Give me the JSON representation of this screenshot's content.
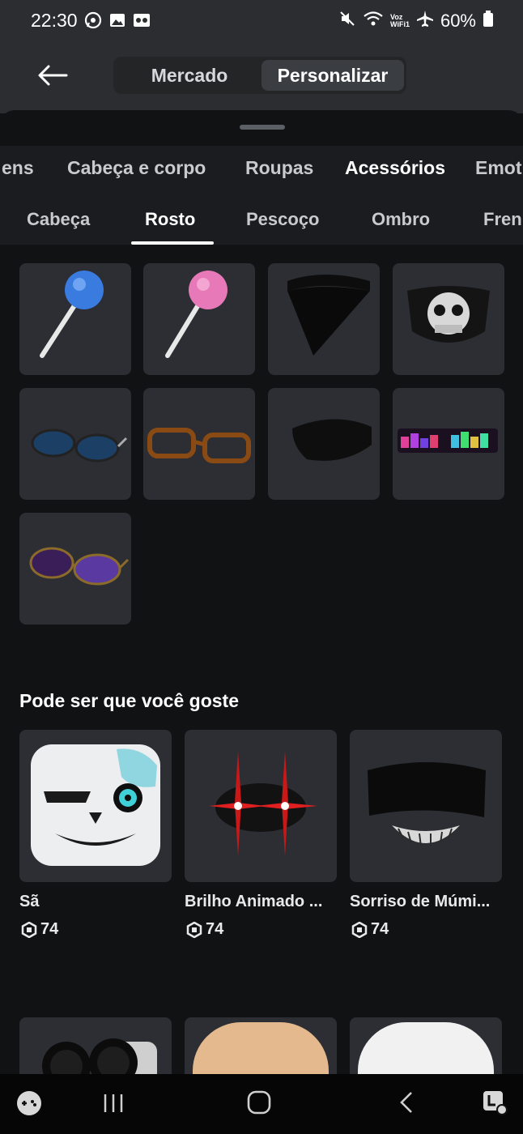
{
  "status_bar": {
    "time": "22:30",
    "battery": "60%",
    "wifi_label_top": "Voz",
    "wifi_label_bottom": "WiFi1",
    "left_icons": [
      "whatsapp-icon",
      "gallery-icon",
      "voicemail-icon"
    ],
    "right_icons": [
      "mute-icon",
      "wifi-icon",
      "airplane-icon",
      "battery-icon"
    ]
  },
  "header": {
    "back_icon": "back-arrow-icon",
    "tabs": [
      {
        "label": "Mercado",
        "active": false
      },
      {
        "label": "Personalizar",
        "active": true
      }
    ]
  },
  "categories": [
    {
      "label": "ens",
      "active": false
    },
    {
      "label": "Cabeça e corpo",
      "active": false
    },
    {
      "label": "Roupas",
      "active": false
    },
    {
      "label": "Acessórios",
      "active": true
    },
    {
      "label": "Emot",
      "active": false
    }
  ],
  "subcategories": [
    {
      "label": "Cabeça",
      "active": false
    },
    {
      "label": "Rosto",
      "active": true
    },
    {
      "label": "Pescoço",
      "active": false
    },
    {
      "label": "Ombro",
      "active": false
    },
    {
      "label": "Fren",
      "active": false
    }
  ],
  "inventory_items": [
    {
      "icon": "blue-lollipop-icon"
    },
    {
      "icon": "pink-lollipop-icon"
    },
    {
      "icon": "black-bandana-icon"
    },
    {
      "icon": "skull-mask-icon"
    },
    {
      "icon": "blue-sunglasses-icon"
    },
    {
      "icon": "brown-glasses-icon"
    },
    {
      "icon": "black-eyepatch-icon"
    },
    {
      "icon": "led-shades-icon"
    },
    {
      "icon": "purple-sunglasses-icon"
    }
  ],
  "recommendations": {
    "title": "Pode ser que você goste",
    "currency_icon": "robux-icon",
    "items": [
      {
        "name": "Sã",
        "price": "74",
        "icon": "sans-head-icon"
      },
      {
        "name": "Brilho Animado ...",
        "price": "74",
        "icon": "red-glow-eyes-icon"
      },
      {
        "name": "Sorriso de Múmi...",
        "price": "74",
        "icon": "mummy-smile-icon"
      }
    ],
    "next_row_icons": [
      "goggles-icon",
      "tan-head-icon",
      "white-head-icon"
    ]
  },
  "nav_bar": {
    "icons": [
      "game-launcher-icon",
      "recent-apps-icon",
      "home-icon",
      "back-icon",
      "assistant-icon"
    ]
  },
  "colors": {
    "background": "#111214",
    "tile": "#2c2e33",
    "header": "#2b2d31",
    "tab_active": "#3a3d42"
  }
}
